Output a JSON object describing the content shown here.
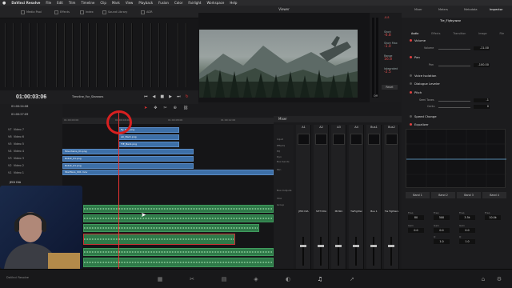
{
  "menubar": {
    "apple": "",
    "app": "DaVinci Resolve",
    "items": [
      "File",
      "Edit",
      "Trim",
      "Timeline",
      "Clip",
      "Mark",
      "View",
      "Playback",
      "Fusion",
      "Color",
      "Fairlight",
      "Workspace",
      "Help"
    ]
  },
  "toolbar": {
    "media_pool": "Media Pool",
    "effects": "Effects",
    "index": "Index",
    "sound_library": "Sound Library",
    "adr": "ADR"
  },
  "viewer": {
    "title": "Viewer"
  },
  "loudness": {
    "peak": "-8.8",
    "short_label": "Short",
    "short": "-6.8",
    "short_max_label": "Short Max",
    "short_max": "-1.0",
    "range_label": "Range",
    "range": "16.8",
    "integrated_label": "Integrated",
    "integrated": "-2.5",
    "reset": "Reset",
    "mode": "Off"
  },
  "inspector": {
    "tabs": [
      "Mixer",
      "Meters",
      "Metadata",
      "Inspector"
    ],
    "clip_name": "Tie_Flyby.wav",
    "subtabs": [
      "Audio",
      "Effects",
      "Transition",
      "Image",
      "File"
    ],
    "sections": {
      "volume": "Volume",
      "volume_label": "Volume",
      "volume_value": "-11.00",
      "pan": "Pan",
      "pan_label": "Pan",
      "pan_value": "-100.00",
      "voice_isolation": "Voice Isolation",
      "dialogue_leveler": "Dialogue Leveler",
      "pitch": "Pitch",
      "semitones_label": "Semi Tones",
      "semitones_value": "-1",
      "cents_label": "Cents",
      "cents_value": "0",
      "speed_change": "Speed Change",
      "equalizer": "Equalizer"
    },
    "bands": [
      "Band 1",
      "Band 2",
      "Band 3",
      "Band 4"
    ],
    "band_freq_label": "Freq",
    "band_freqs": [
      "80",
      "500",
      "3.5k",
      "10.0k"
    ],
    "band_gain_label": "Gain",
    "band_gains": [
      "0.0",
      "0.0",
      "0.0",
      "0.0"
    ],
    "band_q_label": "Q",
    "band_q": [
      "1.0",
      "1.0"
    ]
  },
  "timeline": {
    "timecode": "01:00:03:06",
    "name": "Timeline_For_Starwars",
    "tc_rows": [
      "01:00:24:06",
      "01:00:27:09"
    ],
    "ruler_start": "01:00:00:00",
    "ruler_marks": [
      "01:00:04:00",
      "01:00:08:00",
      "01:00:12:00"
    ],
    "tracks": [
      "V7",
      "V6",
      "V5",
      "V4",
      "V3",
      "V2",
      "V1"
    ],
    "track_names": [
      "Video 7",
      "Video 6",
      "Video 5",
      "Video 4",
      "Video 3",
      "Video 2",
      "Video 1"
    ],
    "clips": [
      "fly_Fog.png",
      "ski_Back.png",
      "TIE_Back.png",
      "Mountains_01.png",
      "Robot_01.png",
      "Robot_01.png",
      "StarWars_001.mov"
    ],
    "audio_track": "JEDI DIA"
  },
  "mixer": {
    "title": "Mixer",
    "strips": [
      "A1",
      "A2",
      "A3",
      "A4",
      "Bus1",
      "Bus2"
    ],
    "channels": [
      "JEDI DIA",
      "SITH DIA",
      "MUSIC",
      "TieFighter",
      "Bus 1",
      "Tie Fighters"
    ],
    "row_labels": [
      "Input",
      "Effects",
      "EQ",
      "Dyn",
      "Bus Sends",
      "Pan",
      "Bus Outputs",
      "VCA",
      "Group"
    ]
  }
}
